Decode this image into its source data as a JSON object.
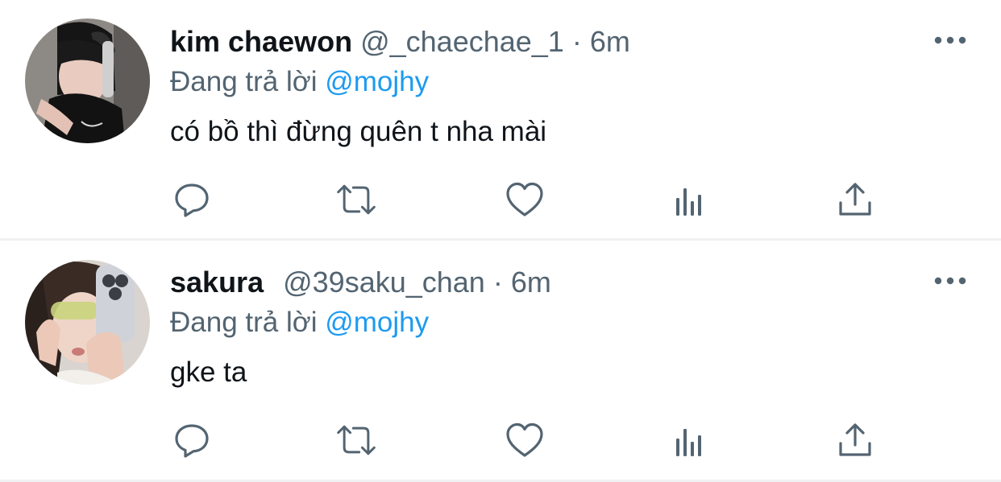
{
  "colors": {
    "text": "#0f1419",
    "secondary": "#536471",
    "link": "#1d9bf0",
    "divider": "#eff1f3"
  },
  "tweets": [
    {
      "display_name": "kim chaewon",
      "handle": "@_chaechae_1",
      "separator": "·",
      "time": "6m",
      "replying_prefix": "Đang trả lời",
      "replying_to": "@mojhy",
      "text": "có bồ thì đừng quên t nha mài",
      "avatar": "profile-photo",
      "actions": [
        "reply-icon",
        "retweet-icon",
        "like-icon",
        "views-icon",
        "share-icon"
      ],
      "menu_icon": "more-options-icon"
    },
    {
      "display_name": "sakura",
      "handle": "@39saku_chan",
      "separator": "·",
      "time": "6m",
      "replying_prefix": "Đang trả lời",
      "replying_to": "@mojhy",
      "text": "gke ta",
      "avatar": "profile-photo",
      "actions": [
        "reply-icon",
        "retweet-icon",
        "like-icon",
        "views-icon",
        "share-icon"
      ],
      "menu_icon": "more-options-icon"
    }
  ]
}
